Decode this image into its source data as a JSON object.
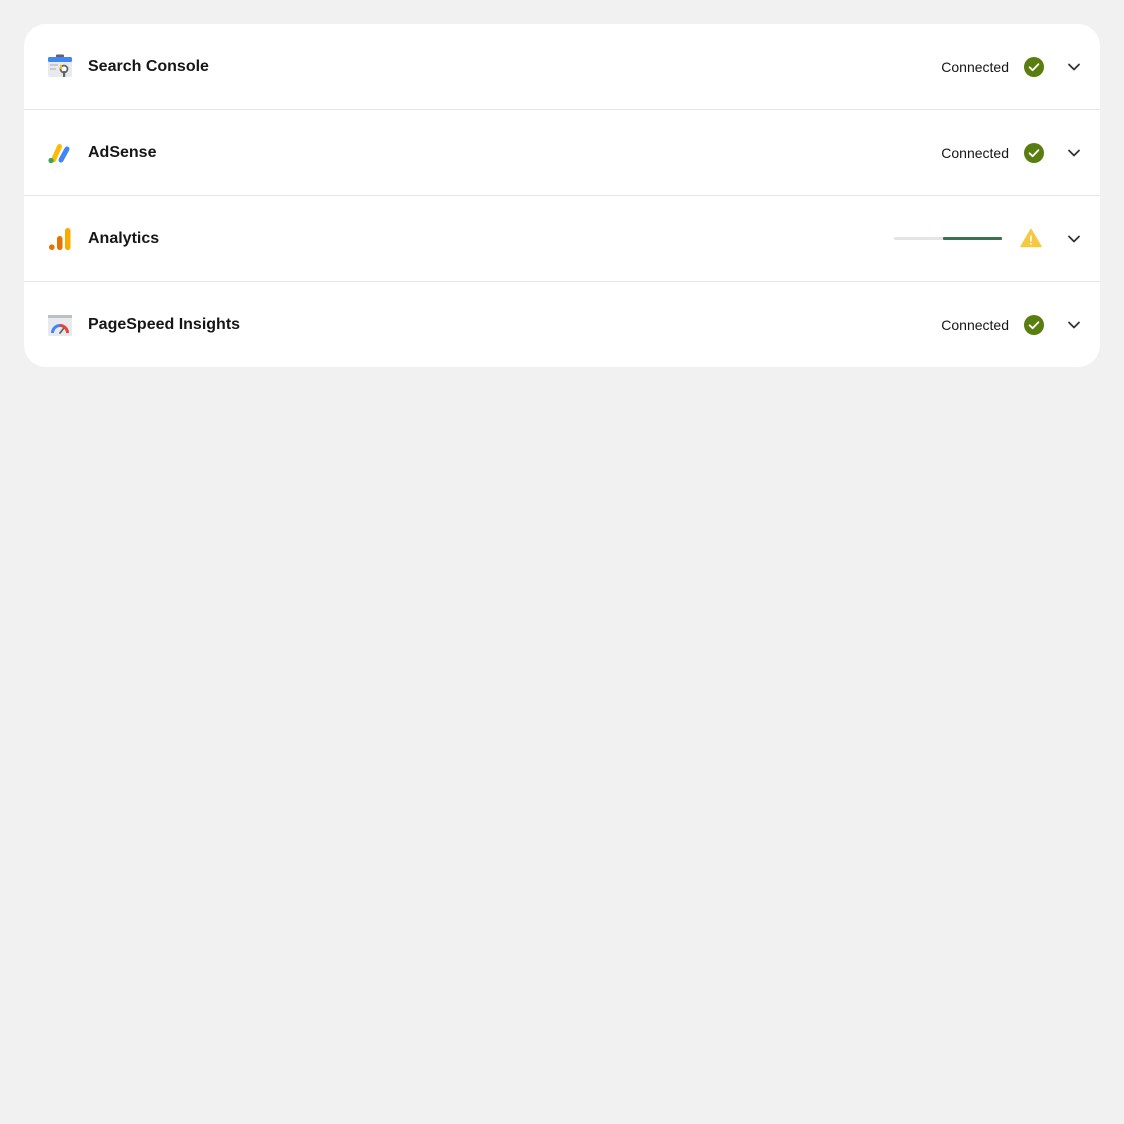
{
  "services": [
    {
      "name": "Search Console",
      "icon": "search-console-logo-icon",
      "status": "Connected",
      "status_icon": "check-circle-icon"
    },
    {
      "name": "AdSense",
      "icon": "adsense-logo-icon",
      "status": "Connected",
      "status_icon": "check-circle-icon"
    },
    {
      "name": "Analytics",
      "icon": "analytics-logo-icon",
      "status_progress_percent": 55,
      "status_icon": "warning-icon"
    },
    {
      "name": "PageSpeed Insights",
      "icon": "pagespeed-insights-logo-icon",
      "status": "Connected",
      "status_icon": "check-circle-icon"
    }
  ],
  "colors": {
    "connected_green": "#587e10",
    "warning_yellow": "#f5c842",
    "progress_fill": "#3c7251",
    "progress_track": "#e4e4e4",
    "page_background": "#f1f1f1"
  }
}
